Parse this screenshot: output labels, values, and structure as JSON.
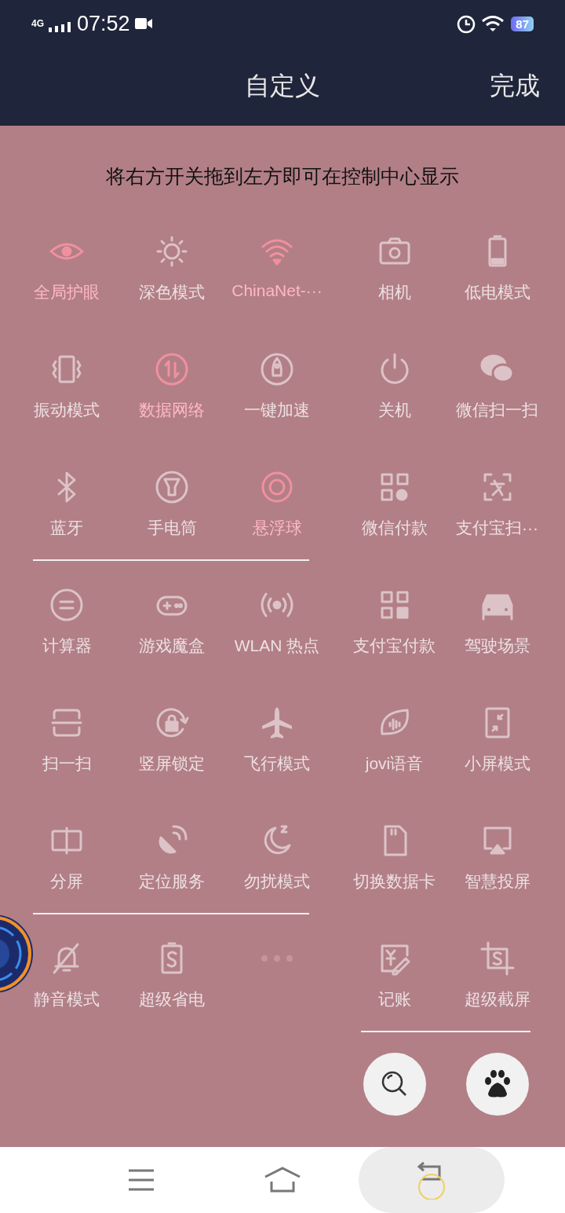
{
  "status_bar": {
    "network": "4G",
    "time": "07:52",
    "battery": "87"
  },
  "header": {
    "title": "自定义",
    "done": "完成"
  },
  "instruction": "将右方开关拖到左方即可在控制中心显示",
  "left_pages": [
    {
      "underlined": true,
      "tiles": [
        {
          "kind": "toggle",
          "label": "全局护眼",
          "on": true
        },
        {
          "kind": "toggle",
          "label": "深色模式",
          "on": false
        },
        {
          "kind": "toggle",
          "label": "ChinaNet-···",
          "on": true
        },
        {
          "kind": "toggle",
          "label": "振动模式",
          "on": false
        },
        {
          "kind": "toggle",
          "label": "数据网络",
          "on": true
        },
        {
          "kind": "toggle",
          "label": "一键加速",
          "on": false
        },
        {
          "kind": "toggle",
          "label": "蓝牙",
          "on": false
        },
        {
          "kind": "toggle",
          "label": "手电筒",
          "on": false
        },
        {
          "kind": "toggle",
          "label": "悬浮球",
          "on": true
        }
      ]
    },
    {
      "underlined": true,
      "tiles": [
        {
          "kind": "toggle",
          "label": "计算器",
          "on": false
        },
        {
          "kind": "toggle",
          "label": "游戏魔盒",
          "on": false
        },
        {
          "kind": "toggle",
          "label": "WLAN 热点",
          "on": false
        },
        {
          "kind": "toggle",
          "label": "扫一扫",
          "on": false
        },
        {
          "kind": "toggle",
          "label": "竖屏锁定",
          "on": false
        },
        {
          "kind": "toggle",
          "label": "飞行模式",
          "on": false
        },
        {
          "kind": "toggle",
          "label": "分屏",
          "on": false
        },
        {
          "kind": "toggle",
          "label": "定位服务",
          "on": false
        },
        {
          "kind": "toggle",
          "label": "勿扰模式",
          "on": false
        }
      ]
    },
    {
      "underlined": false,
      "tiles": [
        {
          "kind": "toggle",
          "label": "静音模式",
          "on": false
        },
        {
          "kind": "toggle",
          "label": "超级省电",
          "on": false
        },
        {
          "kind": "placeholder"
        }
      ]
    }
  ],
  "right_pages": [
    {
      "underlined": true,
      "tiles": [
        {
          "kind": "toggle",
          "label": "相机",
          "on": false
        },
        {
          "kind": "toggle",
          "label": "低电模式",
          "on": false
        },
        {
          "kind": "toggle",
          "label": "关机",
          "on": false
        },
        {
          "kind": "toggle",
          "label": "微信扫一扫",
          "on": false
        },
        {
          "kind": "toggle",
          "label": "微信付款",
          "on": false
        },
        {
          "kind": "toggle",
          "label": "支付宝扫···",
          "on": false
        },
        {
          "kind": "toggle",
          "label": "支付宝付款",
          "on": false
        },
        {
          "kind": "toggle",
          "label": "驾驶场景",
          "on": false
        },
        {
          "kind": "toggle",
          "label": "jovi语音",
          "on": false
        },
        {
          "kind": "toggle",
          "label": "小屏模式",
          "on": false
        },
        {
          "kind": "toggle",
          "label": "切换数据卡",
          "on": false
        },
        {
          "kind": "toggle",
          "label": "智慧投屏",
          "on": false
        },
        {
          "kind": "toggle",
          "label": "记账",
          "on": false
        },
        {
          "kind": "toggle",
          "label": "超级截屏",
          "on": false
        }
      ]
    }
  ]
}
